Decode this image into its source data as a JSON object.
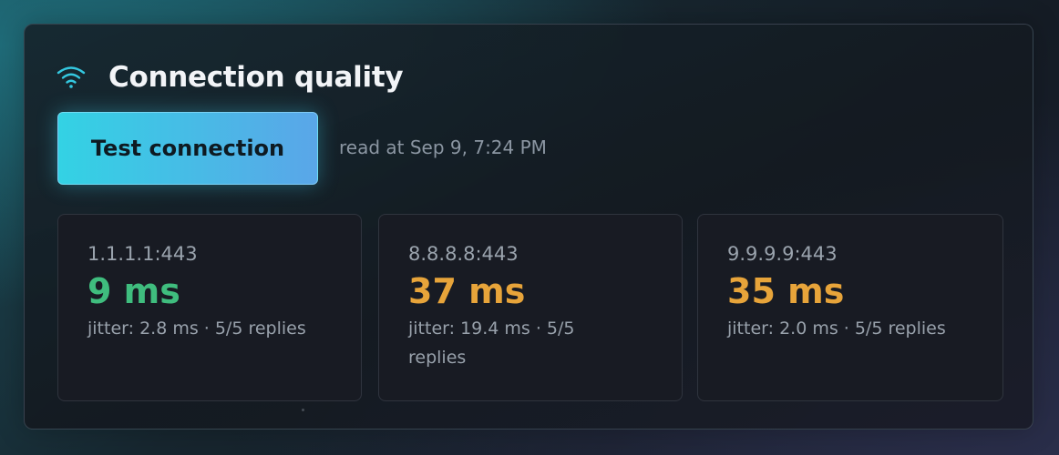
{
  "header": {
    "title": "Connection quality",
    "icon": "wifi-icon",
    "icon_color": "#34c8e0"
  },
  "actions": {
    "test_label": "Test connection",
    "read_at": "read at Sep 9, 7:24 PM"
  },
  "results": [
    {
      "host": "1.1.1.1:443",
      "latency": "9 ms",
      "status": "good",
      "status_color": "#3fbd7e",
      "meta": "jitter: 2.8 ms · 5/5 replies"
    },
    {
      "host": "8.8.8.8:443",
      "latency": "37 ms",
      "status": "warn",
      "status_color": "#e7a43a",
      "meta": "jitter: 19.4 ms · 5/5 replies"
    },
    {
      "host": "9.9.9.9:443",
      "latency": "35 ms",
      "status": "warn",
      "status_color": "#e7a43a",
      "meta": "jitter: 2.0 ms · 5/5 replies"
    }
  ],
  "colors": {
    "accent_start": "#33d2e4",
    "accent_end": "#5aa6e8"
  }
}
